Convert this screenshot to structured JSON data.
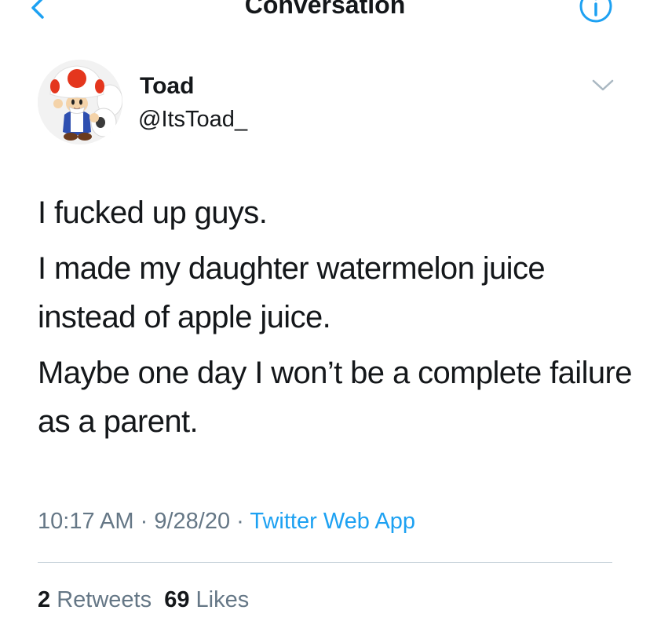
{
  "header": {
    "title": "Conversation",
    "back_icon": "chevron-left-icon",
    "info_icon": "info-icon"
  },
  "tweet": {
    "author": {
      "display_name": "Toad",
      "handle": "@ItsToad_",
      "avatar_icon": "toad-avatar"
    },
    "more_icon": "chevron-down-icon",
    "paragraphs": [
      "I fucked up guys.",
      "I made my daughter watermelon juice instead of apple juice.",
      "Maybe one day I won’t be a complete failure as a parent."
    ],
    "time": "10:17 AM",
    "date": "9/28/20",
    "separator": "·",
    "source": "Twitter Web App",
    "stats": {
      "retweets_count": "2",
      "retweets_label": "Retweets",
      "likes_count": "69",
      "likes_label": "Likes"
    }
  },
  "colors": {
    "accent": "#1da1f2",
    "text": "#14171a",
    "secondary": "#657786",
    "divider": "#ccd6dd"
  }
}
